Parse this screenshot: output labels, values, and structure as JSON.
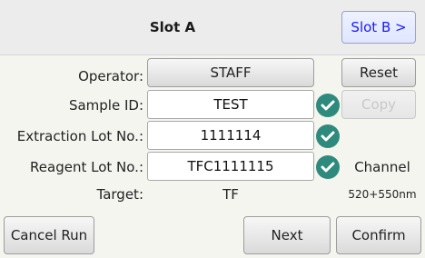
{
  "header": {
    "title": "Slot A",
    "slot_b_button": "Slot B >"
  },
  "form": {
    "operator": {
      "label": "Operator:",
      "value": "STAFF"
    },
    "sample_id": {
      "label": "Sample ID:",
      "value": "TEST"
    },
    "extraction_lot": {
      "label": "Extraction Lot No.:",
      "value": "1111114"
    },
    "reagent_lot": {
      "label": "Reagent Lot No.:",
      "value": "TFC1111115"
    },
    "target": {
      "label": "Target:",
      "value": "TF"
    }
  },
  "side": {
    "reset": "Reset",
    "copy": "Copy",
    "channel_label": "Channel",
    "channel_value": "520+550nm"
  },
  "footer": {
    "cancel": "Cancel Run",
    "next": "Next",
    "confirm": "Confirm"
  },
  "colors": {
    "check": "#2e8a7c",
    "slot_b_text": "#1a1aff"
  }
}
